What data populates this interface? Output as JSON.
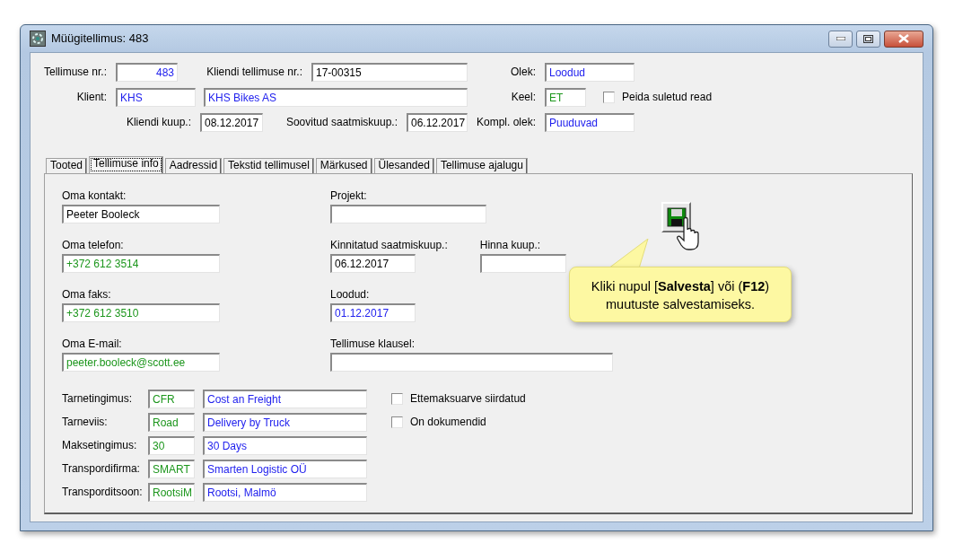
{
  "window": {
    "title": "Müügitellimus: 483"
  },
  "header_rows": [
    [
      {
        "kind": "label",
        "text": "Tellimuse nr.:"
      },
      {
        "kind": "field",
        "value": "483",
        "color": "#2222ee"
      },
      {
        "kind": "label",
        "text": "Kliendi tellimuse nr.:"
      },
      {
        "kind": "field",
        "value": "17-00315"
      },
      {
        "kind": "label",
        "text": "Olek:"
      },
      {
        "kind": "field",
        "value": "Loodud",
        "color": "#2222ee"
      }
    ],
    [
      {
        "kind": "label",
        "text": "Klient:"
      },
      {
        "kind": "field",
        "value": "KHS",
        "color": "#2222ee"
      },
      {
        "kind": "field",
        "value": "KHS Bikes AS",
        "color": "#2222ee"
      },
      {
        "kind": "label",
        "text": "Keel:"
      },
      {
        "kind": "field",
        "value": "ET",
        "color": "#1c961c"
      },
      {
        "kind": "checkbox",
        "label": "Peida suletud read",
        "checked": false
      }
    ],
    [
      {
        "kind": "label",
        "text": "Kliendi kuup.:"
      },
      {
        "kind": "field",
        "value": "08.12.2017"
      },
      {
        "kind": "label",
        "text": "Soovitud saatmiskuup.:"
      },
      {
        "kind": "field",
        "value": "06.12.2017"
      },
      {
        "kind": "label",
        "text": "Kompl. olek:"
      },
      {
        "kind": "field",
        "value": "Puuduvad",
        "color": "#2222ee"
      }
    ]
  ],
  "tabs": [
    {
      "label": "Tooted",
      "selected": false
    },
    {
      "label": "Tellimuse info",
      "selected": true
    },
    {
      "label": "Aadressid",
      "selected": false
    },
    {
      "label": "Tekstid tellimusel",
      "selected": false
    },
    {
      "label": "Märkused",
      "selected": false
    },
    {
      "label": "Ülesanded",
      "selected": false
    },
    {
      "label": "Tellimuse ajalugu",
      "selected": false
    }
  ],
  "info_left": [
    {
      "label": "Oma kontakt:",
      "value": "Peeter Booleck"
    },
    {
      "label": "Oma telefon:",
      "value": "+372 612 3514",
      "color": "#1c961c"
    },
    {
      "label": "Oma faks:",
      "value": "+372 612 3510",
      "color": "#1c961c"
    },
    {
      "label": "Oma E-mail:",
      "value": "peeter.booleck@scott.ee",
      "color": "#1c961c"
    }
  ],
  "info_right": [
    [
      {
        "label": "Projekt:"
      }
    ],
    [
      {
        "label": "Kinnitatud saatmiskuup.:",
        "value": "06.12.2017"
      },
      {
        "label": "Hinna kuup.:"
      }
    ],
    [
      {
        "label": "Loodud:",
        "value": "01.12.2017",
        "color": "#2222ee"
      }
    ],
    [
      {
        "label": "Tellimuse klausel:"
      }
    ]
  ],
  "terms": [
    {
      "label": "Tarnetingimus:",
      "code": "CFR",
      "name": "Cost an Freight"
    },
    {
      "label": "Tarneviis:",
      "code": "Road",
      "name": "Delivery by Truck"
    },
    {
      "label": "Maksetingimus:",
      "code": "30",
      "name": "30 Days"
    },
    {
      "label": "Transpordifirma:",
      "code": "SMART",
      "name": "Smarten Logistic OÜ"
    },
    {
      "label": "Transporditsoon:",
      "code": "RootsiM",
      "name": "Rootsi, Malmö"
    }
  ],
  "options": [
    {
      "label": "Ettemaksuarve siirdatud",
      "checked": false
    },
    {
      "label": "On dokumendid",
      "checked": false
    }
  ],
  "callout": {
    "text": "Kliki nupul [**Salvesta**] või (**F12**) muutuste salvestamiseks."
  }
}
